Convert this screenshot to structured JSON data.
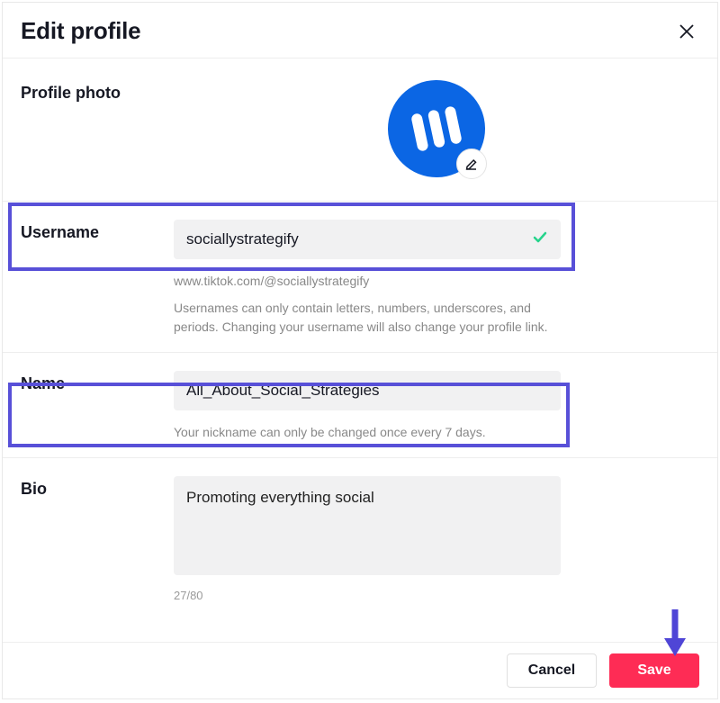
{
  "header": {
    "title": "Edit profile"
  },
  "sections": {
    "photo_label": "Profile photo",
    "username": {
      "label": "Username",
      "value": "sociallystrategify",
      "url_hint": "www.tiktok.com/@sociallystrategify",
      "rules_hint": "Usernames can only contain letters, numbers, underscores, and periods. Changing your username will also change your profile link."
    },
    "name": {
      "label": "Name",
      "value": "All_About_Social_Strategies",
      "hint": "Your nickname can only be changed once every 7 days."
    },
    "bio": {
      "label": "Bio",
      "value": "Promoting everything social",
      "counter": "27/80"
    }
  },
  "footer": {
    "cancel": "Cancel",
    "save": "Save"
  }
}
